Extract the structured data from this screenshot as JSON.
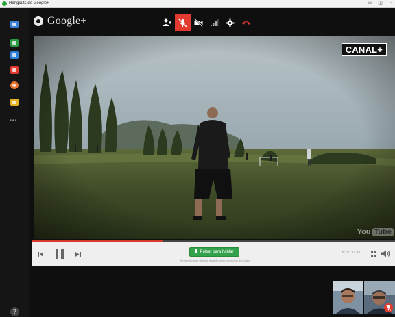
{
  "window": {
    "title": "Hangouts de Google+",
    "minimize_glyph": "▭",
    "maximize_glyph": "◫",
    "close_glyph": "▫"
  },
  "rail": {
    "items": [
      {
        "name": "chat-icon",
        "color": "#3b82d6"
      },
      {
        "name": "screenshare-icon",
        "color": "#2d9b43"
      },
      {
        "name": "capture-icon",
        "color": "#2f7fd8"
      },
      {
        "name": "youtube-icon",
        "color": "#e03a2f"
      },
      {
        "name": "effects-icon",
        "color": "#e9752f"
      },
      {
        "name": "photos-icon",
        "color": "#e4b225"
      }
    ],
    "more_label": "•••",
    "help_label": "?"
  },
  "header": {
    "brand": "Google+",
    "controls": [
      {
        "name": "invite-people-icon",
        "active": false
      },
      {
        "name": "microphone-muted-icon",
        "active": true
      },
      {
        "name": "camera-off-icon",
        "active": false
      },
      {
        "name": "bandwidth-icon",
        "active": false
      },
      {
        "name": "settings-icon",
        "active": false
      },
      {
        "name": "end-call-icon",
        "active": false
      }
    ]
  },
  "video": {
    "channel_logo": "CANAL+",
    "watermark_you": "You",
    "watermark_tube": "Tube",
    "progress": 0.36,
    "accent": "#d73a2d"
  },
  "player": {
    "push_to_talk_label": "Pulsar para hablar",
    "push_to_talk_hint": "El micrófono se silencia durante la reproducción del vídeo",
    "time": "8:15 / 22:21",
    "button_color": "#34a24a"
  },
  "participants": [
    {
      "name": "participant-1",
      "muted": false
    },
    {
      "name": "participant-2",
      "muted": true
    }
  ]
}
